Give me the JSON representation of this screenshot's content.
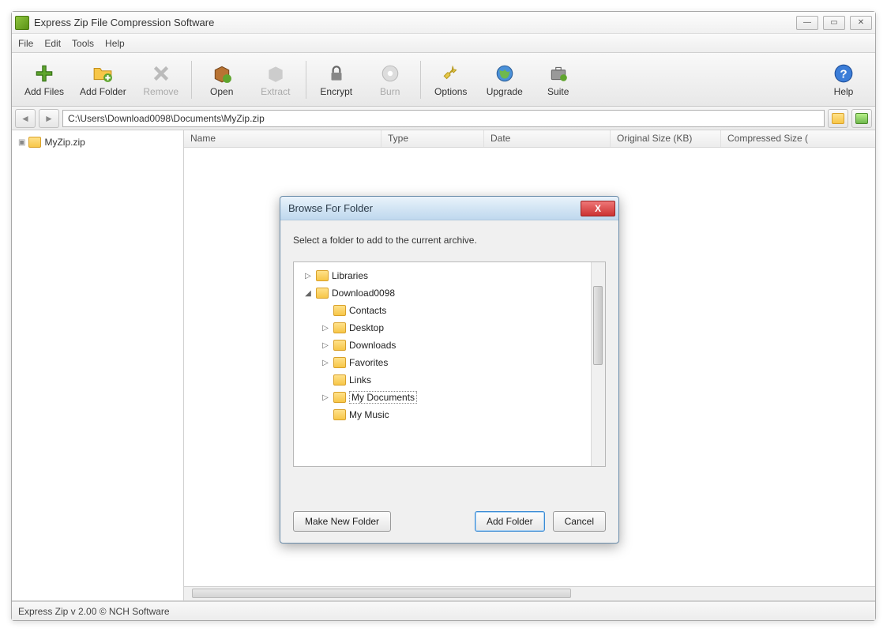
{
  "window": {
    "title": "Express Zip File Compression Software"
  },
  "menubar": [
    "File",
    "Edit",
    "Tools",
    "Help"
  ],
  "toolbar": {
    "add_files": "Add Files",
    "add_folder": "Add Folder",
    "remove": "Remove",
    "open": "Open",
    "extract": "Extract",
    "encrypt": "Encrypt",
    "burn": "Burn",
    "options": "Options",
    "upgrade": "Upgrade",
    "suite": "Suite",
    "help": "Help"
  },
  "path": "C:\\Users\\Download0098\\Documents\\MyZip.zip",
  "tree": {
    "root": "MyZip.zip"
  },
  "columns": {
    "name": "Name",
    "type": "Type",
    "date": "Date",
    "orig": "Original Size (KB)",
    "comp": "Compressed Size ("
  },
  "status": "Express Zip v 2.00 © NCH Software",
  "dialog": {
    "title": "Browse For Folder",
    "instruction": "Select a folder to add to the current archive.",
    "items": [
      {
        "label": "Libraries",
        "depth": 0,
        "expander": "▷",
        "selected": false
      },
      {
        "label": "Download0098",
        "depth": 0,
        "expander": "◢",
        "selected": false
      },
      {
        "label": "Contacts",
        "depth": 1,
        "expander": "",
        "selected": false
      },
      {
        "label": "Desktop",
        "depth": 1,
        "expander": "▷",
        "selected": false
      },
      {
        "label": "Downloads",
        "depth": 1,
        "expander": "▷",
        "selected": false
      },
      {
        "label": "Favorites",
        "depth": 1,
        "expander": "▷",
        "selected": false
      },
      {
        "label": "Links",
        "depth": 1,
        "expander": "",
        "selected": false
      },
      {
        "label": "My Documents",
        "depth": 1,
        "expander": "▷",
        "selected": true
      },
      {
        "label": "My Music",
        "depth": 1,
        "expander": "",
        "selected": false
      }
    ],
    "make_new": "Make New Folder",
    "add": "Add Folder",
    "cancel": "Cancel"
  }
}
